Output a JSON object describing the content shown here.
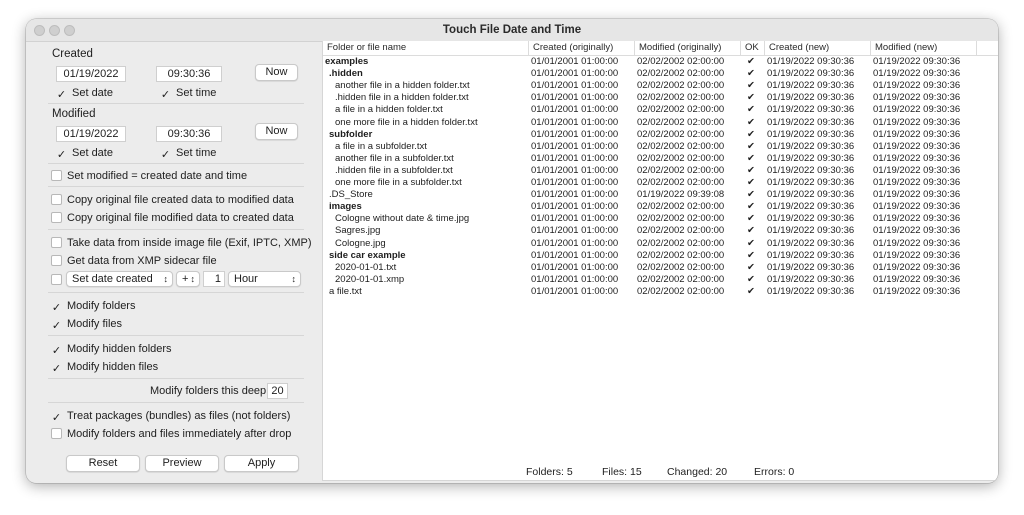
{
  "window": {
    "title": "Touch File Date and Time"
  },
  "created": {
    "label": "Created",
    "date": "01/19/2022",
    "time": "09:30:36",
    "now_label": "Now",
    "set_date_label": "Set date",
    "set_date_checked": true,
    "set_time_label": "Set time",
    "set_time_checked": true
  },
  "modified": {
    "label": "Modified",
    "date": "01/19/2022",
    "time": "09:30:36",
    "now_label": "Now",
    "set_date_label": "Set date",
    "set_date_checked": true,
    "set_time_label": "Set time",
    "set_time_checked": true
  },
  "options": {
    "set_modified_eq_created": {
      "label": "Set modified = created date and time",
      "checked": false
    },
    "copy_created_to_modified": {
      "label": "Copy original file created data to modified data",
      "checked": false
    },
    "copy_modified_to_created": {
      "label": "Copy original file modified data to created data",
      "checked": false
    },
    "take_from_image": {
      "label": "Take data from inside image file (Exif, IPTC, XMP)",
      "checked": false
    },
    "xmp_sidecar": {
      "label": "Get data from XMP sidecar file",
      "checked": false
    },
    "offset_enabled": false,
    "offset_field": "Set date created",
    "offset_sign": "+",
    "offset_amount": "1",
    "offset_unit": "Hour",
    "modify_folders": {
      "label": "Modify folders",
      "checked": true
    },
    "modify_files": {
      "label": "Modify files",
      "checked": true
    },
    "modify_hidden_folders": {
      "label": "Modify hidden folders",
      "checked": true
    },
    "modify_hidden_files": {
      "label": "Modify hidden files",
      "checked": true
    },
    "depth_label": "Modify folders this deep:",
    "depth_value": "20",
    "treat_packages": {
      "label": "Treat packages (bundles) as files (not folders)",
      "checked": true
    },
    "modify_after_drop": {
      "label": "Modify folders and files immediately after drop",
      "checked": false
    }
  },
  "buttons": {
    "reset": "Reset",
    "preview": "Preview",
    "apply": "Apply"
  },
  "table": {
    "headers": [
      "Folder or file name",
      "Created (originally)",
      "Modified (originally)",
      "OK",
      "Created (new)",
      "Modified (new)"
    ],
    "rows": [
      {
        "name": "examples",
        "indent": 0,
        "bold": true,
        "co": "01/01/2001  01:00:00",
        "mo": "02/02/2002  02:00:00",
        "ok": "✔",
        "cn": "01/19/2022  09:30:36",
        "mn": "01/19/2022  09:30:36"
      },
      {
        "name": ".hidden",
        "indent": 1,
        "bold": true,
        "co": "01/01/2001  01:00:00",
        "mo": "02/02/2002  02:00:00",
        "ok": "✔",
        "cn": "01/19/2022  09:30:36",
        "mn": "01/19/2022  09:30:36"
      },
      {
        "name": "another file in a hidden folder.txt",
        "indent": 2,
        "bold": false,
        "co": "01/01/2001  01:00:00",
        "mo": "02/02/2002  02:00:00",
        "ok": "✔",
        "cn": "01/19/2022  09:30:36",
        "mn": "01/19/2022  09:30:36"
      },
      {
        "name": ".hidden file in a hidden folder.txt",
        "indent": 2,
        "bold": false,
        "co": "01/01/2001  01:00:00",
        "mo": "02/02/2002  02:00:00",
        "ok": "✔",
        "cn": "01/19/2022  09:30:36",
        "mn": "01/19/2022  09:30:36"
      },
      {
        "name": "a file in a hidden folder.txt",
        "indent": 2,
        "bold": false,
        "co": "01/01/2001  01:00:00",
        "mo": "02/02/2002  02:00:00",
        "ok": "✔",
        "cn": "01/19/2022  09:30:36",
        "mn": "01/19/2022  09:30:36"
      },
      {
        "name": "one more file in a hidden folder.txt",
        "indent": 2,
        "bold": false,
        "co": "01/01/2001  01:00:00",
        "mo": "02/02/2002  02:00:00",
        "ok": "✔",
        "cn": "01/19/2022  09:30:36",
        "mn": "01/19/2022  09:30:36"
      },
      {
        "name": "subfolder",
        "indent": 1,
        "bold": true,
        "co": "01/01/2001  01:00:00",
        "mo": "02/02/2002  02:00:00",
        "ok": "✔",
        "cn": "01/19/2022  09:30:36",
        "mn": "01/19/2022  09:30:36"
      },
      {
        "name": "a file in a subfolder.txt",
        "indent": 2,
        "bold": false,
        "co": "01/01/2001  01:00:00",
        "mo": "02/02/2002  02:00:00",
        "ok": "✔",
        "cn": "01/19/2022  09:30:36",
        "mn": "01/19/2022  09:30:36"
      },
      {
        "name": "another file in a subfolder.txt",
        "indent": 2,
        "bold": false,
        "co": "01/01/2001  01:00:00",
        "mo": "02/02/2002  02:00:00",
        "ok": "✔",
        "cn": "01/19/2022  09:30:36",
        "mn": "01/19/2022  09:30:36"
      },
      {
        "name": ".hidden file in a subfolder.txt",
        "indent": 2,
        "bold": false,
        "co": "01/01/2001  01:00:00",
        "mo": "02/02/2002  02:00:00",
        "ok": "✔",
        "cn": "01/19/2022  09:30:36",
        "mn": "01/19/2022  09:30:36"
      },
      {
        "name": "one more file in a subfolder.txt",
        "indent": 2,
        "bold": false,
        "co": "01/01/2001  01:00:00",
        "mo": "02/02/2002  02:00:00",
        "ok": "✔",
        "cn": "01/19/2022  09:30:36",
        "mn": "01/19/2022  09:30:36"
      },
      {
        "name": ".DS_Store",
        "indent": 1,
        "bold": false,
        "co": "01/01/2001  01:00:00",
        "mo": "01/19/2022  09:39:08",
        "ok": "✔",
        "cn": "01/19/2022  09:30:36",
        "mn": "01/19/2022  09:30:36"
      },
      {
        "name": "images",
        "indent": 1,
        "bold": true,
        "co": "01/01/2001  01:00:00",
        "mo": "02/02/2002  02:00:00",
        "ok": "✔",
        "cn": "01/19/2022  09:30:36",
        "mn": "01/19/2022  09:30:36"
      },
      {
        "name": "Cologne without date & time.jpg",
        "indent": 2,
        "bold": false,
        "co": "01/01/2001  01:00:00",
        "mo": "02/02/2002  02:00:00",
        "ok": "✔",
        "cn": "01/19/2022  09:30:36",
        "mn": "01/19/2022  09:30:36"
      },
      {
        "name": "Sagres.jpg",
        "indent": 2,
        "bold": false,
        "co": "01/01/2001  01:00:00",
        "mo": "02/02/2002  02:00:00",
        "ok": "✔",
        "cn": "01/19/2022  09:30:36",
        "mn": "01/19/2022  09:30:36"
      },
      {
        "name": "Cologne.jpg",
        "indent": 2,
        "bold": false,
        "co": "01/01/2001  01:00:00",
        "mo": "02/02/2002  02:00:00",
        "ok": "✔",
        "cn": "01/19/2022  09:30:36",
        "mn": "01/19/2022  09:30:36"
      },
      {
        "name": "side car example",
        "indent": 1,
        "bold": true,
        "co": "01/01/2001  01:00:00",
        "mo": "02/02/2002  02:00:00",
        "ok": "✔",
        "cn": "01/19/2022  09:30:36",
        "mn": "01/19/2022  09:30:36"
      },
      {
        "name": "2020-01-01.txt",
        "indent": 2,
        "bold": false,
        "co": "01/01/2001  01:00:00",
        "mo": "02/02/2002  02:00:00",
        "ok": "✔",
        "cn": "01/19/2022  09:30:36",
        "mn": "01/19/2022  09:30:36"
      },
      {
        "name": "2020-01-01.xmp",
        "indent": 2,
        "bold": false,
        "co": "01/01/2001  01:00:00",
        "mo": "02/02/2002  02:00:00",
        "ok": "✔",
        "cn": "01/19/2022  09:30:36",
        "mn": "01/19/2022  09:30:36"
      },
      {
        "name": "a file.txt",
        "indent": 1,
        "bold": false,
        "co": "01/01/2001  01:00:00",
        "mo": "02/02/2002  02:00:00",
        "ok": "✔",
        "cn": "01/19/2022  09:30:36",
        "mn": "01/19/2022  09:30:36"
      }
    ]
  },
  "status": {
    "folders": "Folders:  5",
    "files": "Files:  15",
    "changed": "Changed:  20",
    "errors": "Errors:  0"
  }
}
